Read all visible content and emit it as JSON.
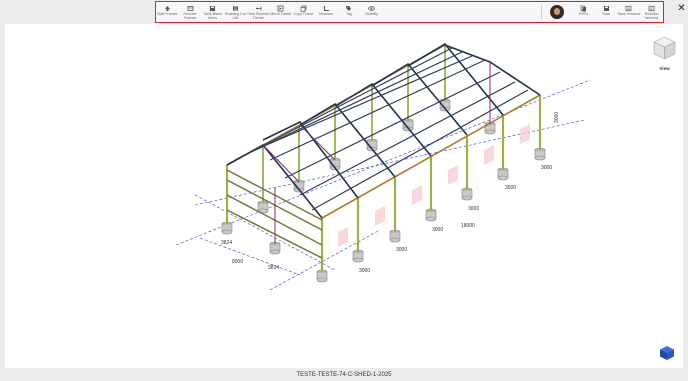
{
  "toolbar": {
    "left_buttons": [
      {
        "label": "Split Frames",
        "icon": "upload-icon"
      },
      {
        "label": "Reorder Frames",
        "icon": "frames-icon"
      },
      {
        "label": "Save Blank Items",
        "icon": "save-icon"
      },
      {
        "label": "Enabling Cut List",
        "icon": "list-icon"
      },
      {
        "label": "Third Element Theme",
        "icon": "resize-icon"
      },
      {
        "label": "Mirror Frame",
        "icon": "mirror-icon"
      },
      {
        "label": "Copy Frame",
        "icon": "copy-icon"
      },
      {
        "label": "Measure",
        "icon": "ruler-icon"
      },
      {
        "label": "Tag",
        "icon": "tag-icon"
      },
      {
        "label": "Visibility",
        "icon": "eye-icon"
      }
    ],
    "right_buttons": [
      {
        "label": "PDFs",
        "icon": "pdf-icon"
      },
      {
        "label": "Save",
        "icon": "save-icon"
      },
      {
        "label": "Save Versions",
        "icon": "versions-icon"
      },
      {
        "label": "Revision Versions",
        "icon": "revision-icon"
      }
    ]
  },
  "close_symbol": "✕",
  "viewcube": {
    "label": "View"
  },
  "dimensions": {
    "bay_spacing": [
      "3000",
      "3000",
      "3000",
      "3000",
      "3000"
    ],
    "end_bays": [
      "3824",
      "3824"
    ],
    "span": "8000",
    "length": "18000",
    "height": "3000"
  },
  "footer": {
    "filename": "TESTE-TESTE-74-C-SHED-1-2025"
  },
  "colors": {
    "toolbar_border": "#e0202a",
    "column": "#9bb04a",
    "rafter": "#1f3350",
    "purlin": "#2e3e5e",
    "eave": "#b07a2a",
    "bracing": "#8a2a6a",
    "axis": "#3a3ad6"
  }
}
